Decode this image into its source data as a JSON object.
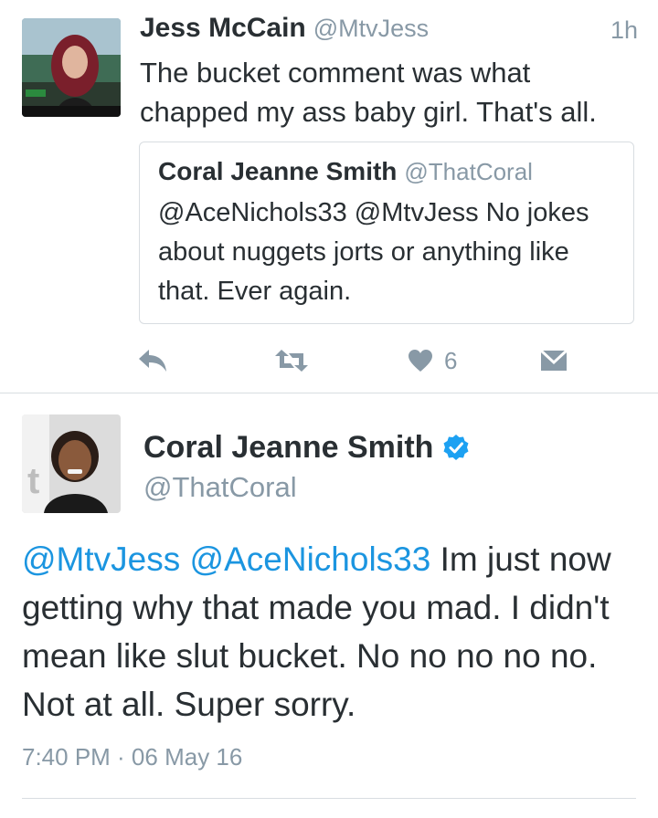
{
  "tweet": {
    "author_name": "Jess McCain",
    "author_handle": "@MtvJess",
    "time": "1h",
    "text": "The bucket comment was what chapped my ass baby girl. That's all.",
    "avatar_icon": "profile-photo-icon",
    "quoted": {
      "author_name": "Coral Jeanne Smith",
      "author_handle": "@ThatCoral",
      "text": "@AceNichols33 @MtvJess No jokes about nuggets jorts or anything like that. Ever again."
    },
    "actions": {
      "reply_icon": "reply-icon",
      "retweet_icon": "retweet-icon",
      "like_icon": "heart-icon",
      "like_count": "6",
      "message_icon": "direct-message-icon"
    }
  },
  "main_tweet": {
    "author_name": "Coral Jeanne Smith",
    "verified_icon": "verified-badge-icon",
    "author_handle": "@ThatCoral",
    "mention_1": "@MtvJess",
    "mention_2": "@AceNichols33",
    "text_rest": " Im just now getting why that made you mad. I didn't mean like slut bucket. No no no no no. Not at all. Super sorry.",
    "timestamp": "7:40 PM · 06 May 16"
  },
  "colors": {
    "link": "#1b95e0",
    "muted": "#8899a6",
    "text": "#292f33",
    "border": "#d8dde1"
  }
}
